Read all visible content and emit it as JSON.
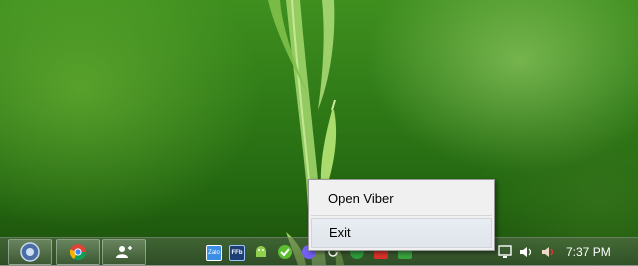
{
  "context_menu": {
    "items": [
      {
        "label": "Open Viber"
      },
      {
        "label": "Exit"
      }
    ]
  },
  "taskbar": {
    "pinned": [
      {
        "icon": "start-orb-icon"
      },
      {
        "icon": "chrome-icon"
      },
      {
        "icon": "contacts-icon"
      }
    ],
    "tray_icons": [
      "zalo-icon",
      "fb-icon",
      "android-icon",
      "check-icon",
      "viber-icon",
      "reload-icon",
      "antivirus-icon",
      "red-app-icon",
      "green-app-icon",
      "monitor-icon",
      "volume-icon",
      "mute-icon"
    ],
    "tray_texts": {
      "zalo": "Zalo",
      "fb": "FFb"
    },
    "clock": "7:37 PM"
  },
  "colors": {
    "menu_bg": "#f0f0f0",
    "menu_hover": "#dfe5eb",
    "viber_purple": "#7360f2"
  }
}
